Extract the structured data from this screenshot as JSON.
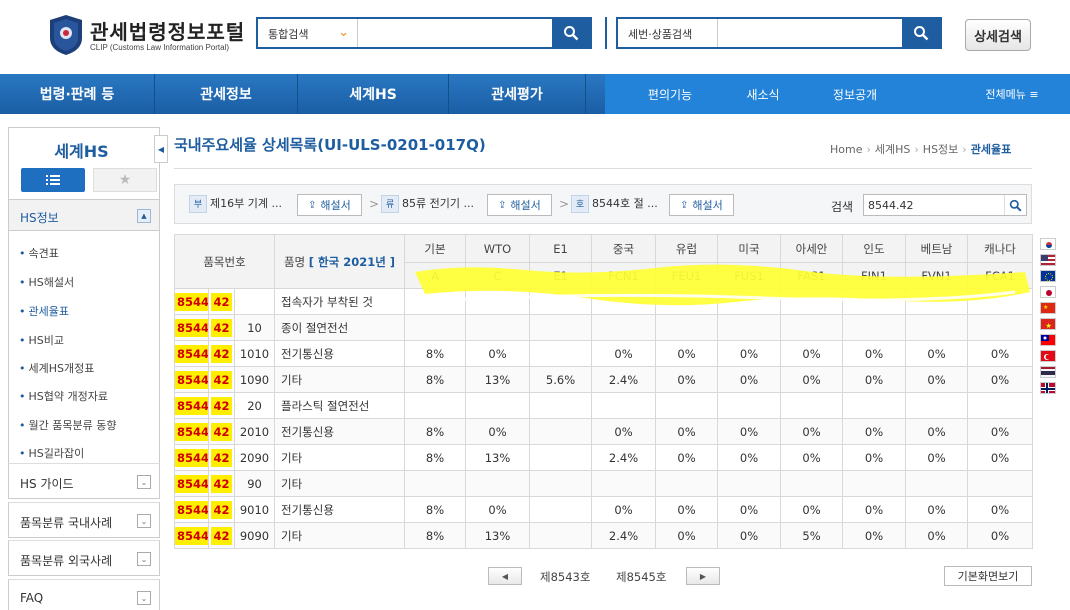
{
  "header": {
    "logo_title": "관세법령정보포털",
    "logo_subtitle": "CLIP (Customs Law Information Portal)",
    "emblem_text": "KOREA CUSTOMS SERVICE",
    "search1": {
      "select_label": "통합검색",
      "value": ""
    },
    "search2": {
      "label": "세번·상품검색",
      "value": ""
    },
    "advanced_search": "상세검색"
  },
  "nav": {
    "main": [
      "법령·판례 등",
      "관세정보",
      "세계HS",
      "관세평가"
    ],
    "sub": [
      "편의기능",
      "새소식",
      "정보공개"
    ],
    "all_menu": "전체메뉴 ≡"
  },
  "sidebar": {
    "title": "세계HS",
    "section": "HS정보",
    "items": [
      {
        "label": "속견표",
        "active": false
      },
      {
        "label": "HS해설서",
        "active": false
      },
      {
        "label": "관세율표",
        "active": true
      },
      {
        "label": "HS비교",
        "active": false
      },
      {
        "label": "세계HS개정표",
        "active": false
      },
      {
        "label": "HS협약 개정자료",
        "active": false
      },
      {
        "label": "월간 품목분류 동향",
        "active": false
      },
      {
        "label": "HS길라잡이",
        "active": false
      }
    ],
    "groups": [
      "HS 가이드",
      "품목분류 국내사례",
      "품목분류 외국사례",
      "FAQ"
    ]
  },
  "page": {
    "title": "국내주요세율 상세목록(UI-ULS-0201-017Q)",
    "breadcrumb": [
      "Home",
      "세계HS",
      "HS정보",
      "관세율표"
    ]
  },
  "filter": {
    "section": {
      "tag": "부",
      "text": "제16부 기계 ...",
      "btn": "해설서"
    },
    "chapter": {
      "tag": "류",
      "text": "85류 전기기 ...",
      "btn": "해설서"
    },
    "heading": {
      "tag": "호",
      "text": "8544호 절 ...",
      "btn": "해설서"
    },
    "search_label": "검색",
    "search_value": "8544.42"
  },
  "table": {
    "head_code": "품목번호",
    "head_name": "품명",
    "head_lang": "[ 한국  2021년 ]",
    "rate_cols": [
      {
        "name": "기본",
        "code": "A"
      },
      {
        "name": "WTO",
        "code": "C"
      },
      {
        "name": "E1",
        "code": "E1"
      },
      {
        "name": "중국",
        "code": "FCN1"
      },
      {
        "name": "유럽",
        "code": "FEU1"
      },
      {
        "name": "미국",
        "code": "FUS1"
      },
      {
        "name": "아세안",
        "code": "FAS1"
      },
      {
        "name": "인도",
        "code": "FIN1"
      },
      {
        "name": "베트남",
        "code": "FVN1"
      },
      {
        "name": "캐나다",
        "code": "FCA1"
      }
    ],
    "rows": [
      {
        "c1": "8544",
        "c2": "42",
        "c3": "",
        "name": "접속자가 부착된 것",
        "rates": [
          "",
          "",
          "",
          "",
          "",
          "",
          "",
          "",
          "",
          ""
        ]
      },
      {
        "c1": "8544",
        "c2": "42",
        "c3": "10",
        "name": "종이 절연전선",
        "rates": [
          "",
          "",
          "",
          "",
          "",
          "",
          "",
          "",
          "",
          ""
        ]
      },
      {
        "c1": "8544",
        "c2": "42",
        "c3": "1010",
        "name": "전기통신용",
        "rates": [
          "8%",
          "0%",
          "",
          "0%",
          "0%",
          "0%",
          "0%",
          "0%",
          "0%",
          "0%"
        ]
      },
      {
        "c1": "8544",
        "c2": "42",
        "c3": "1090",
        "name": "기타",
        "rates": [
          "8%",
          "13%",
          "5.6%",
          "2.4%",
          "0%",
          "0%",
          "0%",
          "0%",
          "0%",
          "0%"
        ]
      },
      {
        "c1": "8544",
        "c2": "42",
        "c3": "20",
        "name": "플라스틱 절연전선",
        "rates": [
          "",
          "",
          "",
          "",
          "",
          "",
          "",
          "",
          "",
          ""
        ]
      },
      {
        "c1": "8544",
        "c2": "42",
        "c3": "2010",
        "name": "전기통신용",
        "rates": [
          "8%",
          "0%",
          "",
          "0%",
          "0%",
          "0%",
          "0%",
          "0%",
          "0%",
          "0%"
        ]
      },
      {
        "c1": "8544",
        "c2": "42",
        "c3": "2090",
        "name": "기타",
        "rates": [
          "8%",
          "13%",
          "",
          "2.4%",
          "0%",
          "0%",
          "0%",
          "0%",
          "0%",
          "0%"
        ]
      },
      {
        "c1": "8544",
        "c2": "42",
        "c3": "90",
        "name": "기타",
        "rates": [
          "",
          "",
          "",
          "",
          "",
          "",
          "",
          "",
          "",
          ""
        ]
      },
      {
        "c1": "8544",
        "c2": "42",
        "c3": "9010",
        "name": "전기통신용",
        "rates": [
          "8%",
          "0%",
          "",
          "0%",
          "0%",
          "0%",
          "0%",
          "0%",
          "0%",
          "0%"
        ]
      },
      {
        "c1": "8544",
        "c2": "42",
        "c3": "9090",
        "name": "기타",
        "rates": [
          "8%",
          "13%",
          "",
          "2.4%",
          "0%",
          "0%",
          "5%",
          "0%",
          "0%",
          "0%"
        ]
      }
    ]
  },
  "flags": [
    "korea-flag-icon",
    "usa-flag-icon",
    "eu-flag-icon",
    "japan-flag-icon",
    "china-flag-icon",
    "vietnam-flag-icon",
    "taiwan-flag-icon",
    "turkey-flag-icon",
    "thailand-flag-icon",
    "norway-flag-icon"
  ],
  "pager": {
    "prev_label": "제8543호",
    "next_label": "제8545호",
    "basic_view": "기본화면보기"
  },
  "colors": {
    "brand_blue": "#1e5d9f",
    "nav_blue": "#1a5ea5",
    "code_highlight": "#ffee00",
    "code_text": "#d10000",
    "annotation_yellow": "#ffff33"
  }
}
